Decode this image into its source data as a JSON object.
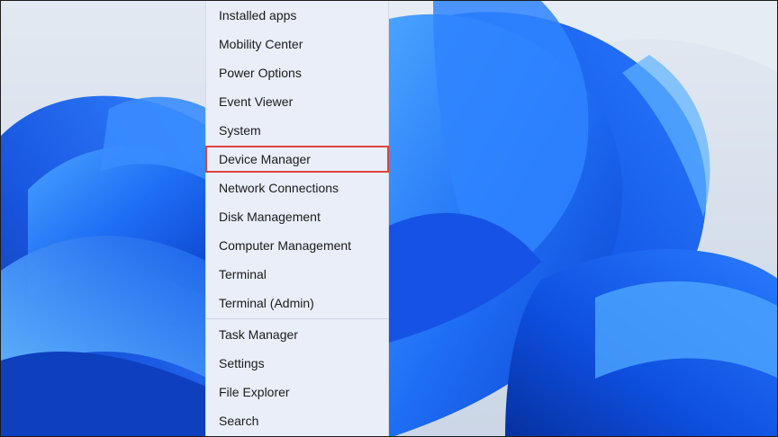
{
  "context_menu": {
    "items": [
      {
        "label": "Installed apps"
      },
      {
        "label": "Mobility Center"
      },
      {
        "label": "Power Options"
      },
      {
        "label": "Event Viewer"
      },
      {
        "label": "System"
      },
      {
        "label": "Device Manager",
        "highlighted": true
      },
      {
        "label": "Network Connections"
      },
      {
        "label": "Disk Management"
      },
      {
        "label": "Computer Management"
      },
      {
        "label": "Terminal"
      },
      {
        "label": "Terminal (Admin)"
      },
      {
        "label": "Task Manager"
      },
      {
        "label": "Settings"
      },
      {
        "label": "File Explorer"
      },
      {
        "label": "Search"
      }
    ],
    "highlight_color": "#e0423c"
  },
  "wallpaper": {
    "name": "windows-11-bloom",
    "accent": "#1b5ff0",
    "background": "#dbe3ee"
  }
}
